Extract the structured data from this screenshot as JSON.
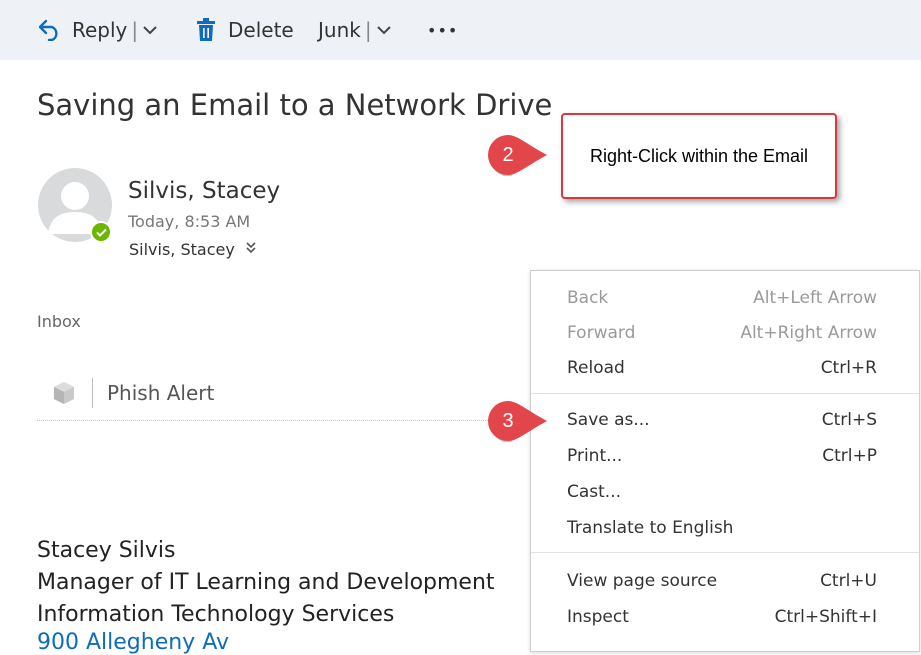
{
  "toolbar": {
    "reply": "Reply",
    "delete": "Delete",
    "junk": "Junk",
    "separator": "|",
    "more": "•••"
  },
  "message": {
    "subject": "Saving an Email to a Network Drive",
    "sender_name": "Silvis, Stacey",
    "time": "Today, 8:53 AM",
    "to": "Silvis, Stacey",
    "folder": "Inbox",
    "addin": "Phish Alert",
    "signature": {
      "name": "Stacey Silvis",
      "role": "Manager of IT Learning and Development",
      "department": "Information Technology Services",
      "address": "900 Allegheny Av"
    }
  },
  "callouts": {
    "step2_number": "2",
    "step2_text": "Right-Click within the Email",
    "step3_number": "3",
    "color": "#d9383e"
  },
  "context_menu": {
    "items": [
      {
        "label": "Back",
        "shortcut": "Alt+Left Arrow",
        "enabled": false
      },
      {
        "label": "Forward",
        "shortcut": "Alt+Right Arrow",
        "enabled": false
      },
      {
        "label": "Reload",
        "shortcut": "Ctrl+R",
        "enabled": true
      },
      {
        "label": "Save as...",
        "shortcut": "Ctrl+S",
        "enabled": true
      },
      {
        "label": "Print...",
        "shortcut": "Ctrl+P",
        "enabled": true
      },
      {
        "label": "Cast...",
        "shortcut": "",
        "enabled": true
      },
      {
        "label": "Translate to English",
        "shortcut": "",
        "enabled": true
      },
      {
        "label": "View page source",
        "shortcut": "Ctrl+U",
        "enabled": true
      },
      {
        "label": "Inspect",
        "shortcut": "Ctrl+Shift+I",
        "enabled": true
      }
    ]
  },
  "colors": {
    "toolbar_bg": "#eef2f7",
    "accent_blue": "#0f6cbd",
    "presence_green": "#6bb700"
  },
  "icons": [
    "reply-icon",
    "delete-icon",
    "chevron-down-icon",
    "more-icon",
    "avatar-icon",
    "presence-available-icon",
    "phish-alert-icon"
  ]
}
